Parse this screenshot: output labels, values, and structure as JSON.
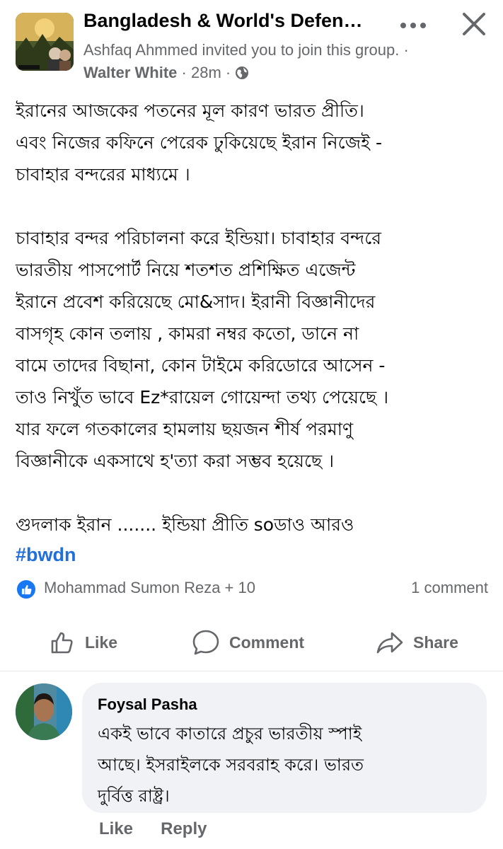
{
  "header": {
    "group_name": "Bangladesh & World's Defen…",
    "invite_text": "Ashfaq Ahmmed invited you to join this group.",
    "separator": "·",
    "author": "Walter White",
    "time": "28m",
    "more_icon": "more-horizontal-icon",
    "close_icon": "close-icon",
    "globe_icon": "globe-icon"
  },
  "post": {
    "paragraphs": [
      "ইরানের আজকের পতনের মূল কারণ ভারত প্রীতি।\nএবং নিজের কফিনে পেরেক ঢুকিয়েছে ইরান নিজেই -\nচাবাহার বন্দরের মাধ্যমে ।",
      "চাবাহার বন্দর পরিচালনা করে ইন্ডিয়া। চাবাহার বন্দরে\nভারতীয় পাসপোর্ট নিয়ে শতশত প্রশিক্ষিত এজেন্ট\nইরানে প্রবেশ করিয়েছে মো&সাদ। ইরানী বিজ্ঞানীদের\nবাসগৃহ কোন তলায় , কামরা নম্বর কতো, ডানে না\nবামে তাদের বিছানা, কোন টাইমে করিডোরে আসেন -\nতাও নিখুঁত ভাবে Ez*রায়েল গোয়েন্দা তথ্য পেয়েছে ।\nযার ফলে গতকালের হামলায় ছয়জন শীর্ষ পরমাণু\nবিজ্ঞানীকে একসাথে হ'ত্যা করা সম্ভব হয়েছে ।",
      "গুদলাক ইরান ....... ইন্ডিয়া প্রীতি soডাও আরও"
    ],
    "hashtag": "#bwdn"
  },
  "reactions": {
    "names": "Mohammad Sumon Reza + 10",
    "comment_count": "1 comment",
    "badge_icon": "like-reaction-icon",
    "badge_color": "#1877f2"
  },
  "actions": {
    "like": "Like",
    "comment": "Comment",
    "share": "Share"
  },
  "comment": {
    "author": "Foysal Pasha",
    "text": "একই ভাবে কাতারে প্রচুর ভারতীয় স্পাই\nআছে। ইসরাইলকে সরবরাহ করে। ভারত\nদুর্বিত্ত রাষ্ট্র।",
    "like": "Like",
    "reply": "Reply"
  },
  "colors": {
    "secondary_text": "#65676b",
    "hashtag": "#216fdb",
    "bubble": "#f0f2f5"
  }
}
